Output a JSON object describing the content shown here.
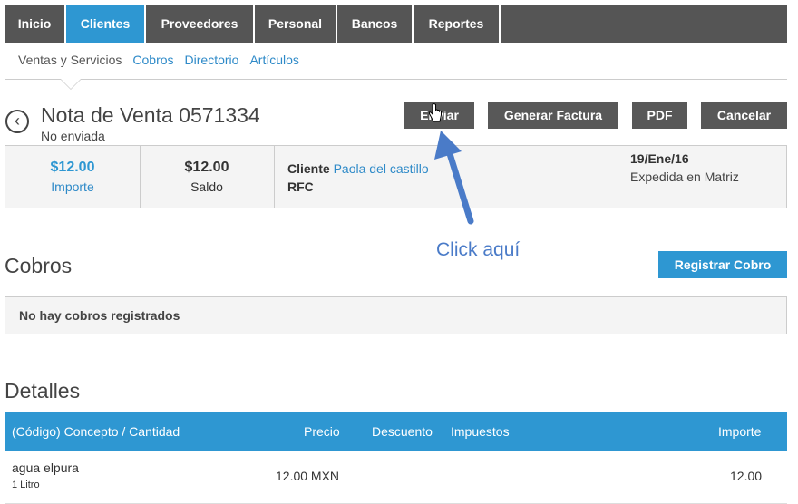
{
  "nav": {
    "tabs": [
      {
        "label": "Inicio"
      },
      {
        "label": "Clientes"
      },
      {
        "label": "Proveedores"
      },
      {
        "label": "Personal"
      },
      {
        "label": "Bancos"
      },
      {
        "label": "Reportes"
      }
    ],
    "active_tab": "Clientes"
  },
  "subnav": {
    "items": [
      {
        "label": "Ventas y Servicios"
      },
      {
        "label": "Cobros"
      },
      {
        "label": "Directorio"
      },
      {
        "label": "Artículos"
      }
    ]
  },
  "header": {
    "title": "Nota de Venta 0571334",
    "status": "No enviada",
    "actions": {
      "send": "Enviar",
      "invoice": "Generar Factura",
      "pdf": "PDF",
      "cancel": "Cancelar"
    }
  },
  "summary": {
    "importe_value": "$12.00",
    "importe_label": "Importe",
    "saldo_value": "$12.00",
    "saldo_label": "Saldo",
    "cliente_label": "Cliente",
    "cliente_name": "Paola del castillo",
    "rfc_label": "RFC",
    "date": "19/Ene/16",
    "issued": "Expedida en Matriz"
  },
  "annotation": {
    "text": "Click aquí"
  },
  "cobros": {
    "title": "Cobros",
    "button": "Registrar Cobro",
    "empty": "No hay cobros registrados"
  },
  "detalles": {
    "title": "Detalles",
    "columns": {
      "concepto": "(Código) Concepto / Cantidad",
      "precio": "Precio",
      "descuento": "Descuento",
      "impuestos": "Impuestos",
      "importe": "Importe"
    },
    "rows": [
      {
        "concepto": "agua elpura",
        "cantidad": "1 Litro",
        "precio": "12.00 MXN",
        "importe": "12.00"
      }
    ]
  },
  "colors": {
    "accent": "#2e97d2",
    "nav_bg": "#555555",
    "button_bg": "#585858",
    "annotation": "#4a7bc8"
  }
}
